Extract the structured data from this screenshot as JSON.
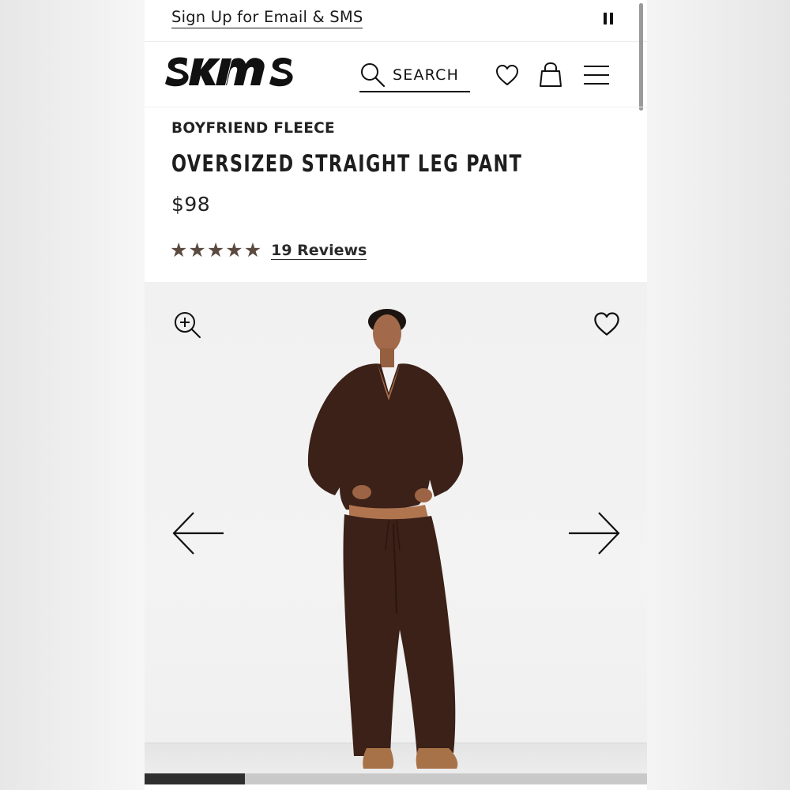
{
  "promo": {
    "link_label": "Sign Up for Email & SMS",
    "pause_icon": "pause-icon"
  },
  "header": {
    "logo_text": "SKIMS",
    "search_label": "SEARCH",
    "icons": [
      "search-icon",
      "heart-icon",
      "shopping-bag-icon",
      "hamburger-menu-icon"
    ]
  },
  "product": {
    "collection": "BOYFRIEND FLEECE",
    "title": "OVERSIZED STRAIGHT LEG PANT",
    "price": "$98",
    "rating": 5,
    "stars": [
      "★",
      "★",
      "★",
      "★",
      "★"
    ],
    "reviews_label": "19 Reviews"
  },
  "gallery": {
    "icons": [
      "zoom-in-icon",
      "heart-icon",
      "arrow-left-icon",
      "arrow-right-icon"
    ],
    "image_subject": "model wearing brown fleece sweater and straight leg pants",
    "progress": 0.2
  },
  "colors": {
    "star": "#5b4a3f",
    "garment": "#3b2118",
    "text": "#1a1a1a"
  }
}
